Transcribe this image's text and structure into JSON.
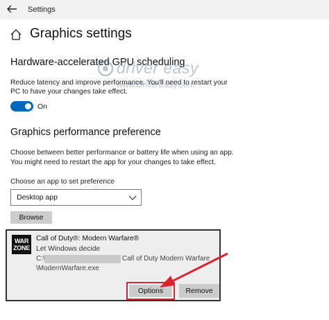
{
  "window": {
    "title": "Settings"
  },
  "page": {
    "title": "Graphics settings"
  },
  "gpu_section": {
    "heading": "Hardware-accelerated GPU scheduling",
    "description_line1": "Reduce latency and improve performance. You'll need to restart your",
    "description_line2": "PC to have your changes take effect.",
    "toggle_state": "On",
    "toggle_on": true
  },
  "watermark": {
    "brand": "driver easy",
    "url": "www.DriverEasy.com"
  },
  "perf_section": {
    "heading": "Graphics performance preference",
    "description_line1": "Choose between better performance or battery life when using an app.",
    "description_line2": "You might need to restart the app for your changes to take effect."
  },
  "app_select": {
    "label": "Choose an app to set preference",
    "value": "Desktop app",
    "browse_label": "Browse"
  },
  "app_entry": {
    "logo_line1": "WAR",
    "logo_line2": "ZONE",
    "name": "Call of Duty®: Modern Warfare®",
    "preference": "Let Windows decide",
    "path_prefix": "C:\\",
    "path_suffix": "Call of Duty Modern Warfare",
    "path_line2": "\\ModernWarfare.exe",
    "options_label": "Options",
    "remove_label": "Remove"
  },
  "colors": {
    "accent": "#0067c0",
    "highlight": "#e0202e",
    "button": "#cccccc"
  }
}
